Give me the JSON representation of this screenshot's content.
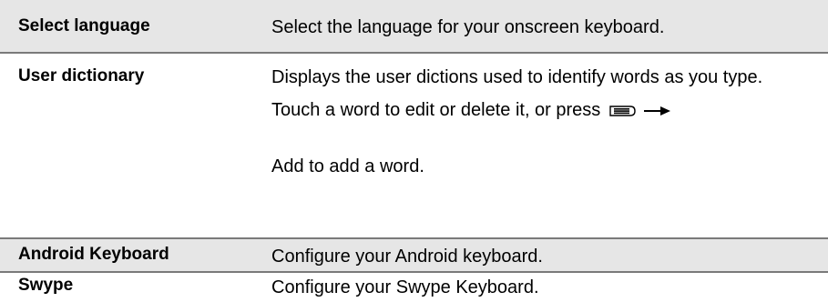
{
  "rows": [
    {
      "term": "Select language",
      "description": "Select the language for your onscreen keyboard."
    },
    {
      "term": "User dictionary",
      "description_1": "Displays the user dictions used to identify words as you type.",
      "description_2": "Touch a word to edit or delete it, or press",
      "icon_menu": "menu-key-icon",
      "icon_arrow": "right-arrow-icon",
      "description_3": "Add to add a word."
    },
    {
      "term": "Android Keyboard",
      "description": "Configure your Android keyboard."
    },
    {
      "term": "Swype",
      "description": "Configure your Swype Keyboard."
    }
  ],
  "colors": {
    "shaded_row": "#e6e6e6",
    "divider": "#7a7a7a",
    "text": "#000000"
  }
}
